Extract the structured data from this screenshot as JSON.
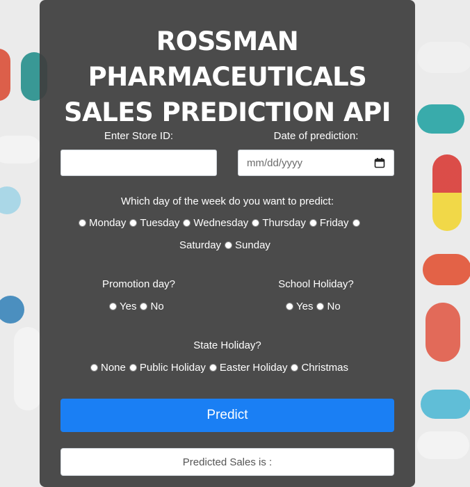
{
  "title_lines": [
    "ROSSMAN",
    "PHARMACEUTICALS",
    "SALES PREDICTION API"
  ],
  "store_id": {
    "label": "Enter Store ID:",
    "value": ""
  },
  "date": {
    "label": "Date of prediction:",
    "placeholder": "mm/dd/yyyy"
  },
  "day_of_week": {
    "question": "Which day of the week do you want to predict:",
    "options": [
      "Monday",
      "Tuesday",
      "Wednesday",
      "Thursday",
      "Friday",
      "Saturday",
      "Sunday"
    ]
  },
  "promotion": {
    "label": "Promotion day?",
    "options": [
      "Yes",
      "No"
    ]
  },
  "school_holiday": {
    "label": "School Holiday?",
    "options": [
      "Yes",
      "No"
    ]
  },
  "state_holiday": {
    "label": "State Holiday?",
    "options": [
      "None",
      "Public Holiday",
      "Easter Holiday",
      "Christmas"
    ]
  },
  "predict_button": "Predict",
  "result_text": "Predicted Sales is :",
  "colors": {
    "panel": "#3e3e3e",
    "button": "#1a7ff4"
  },
  "icons": [
    "calendar-icon"
  ]
}
